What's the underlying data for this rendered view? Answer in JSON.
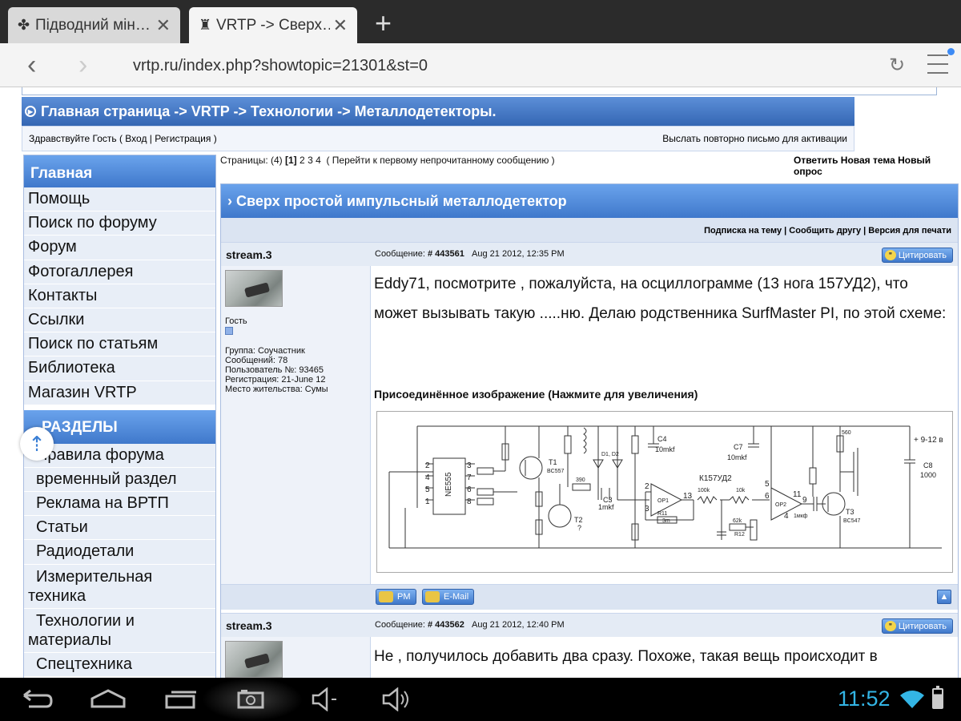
{
  "browser": {
    "tabs": [
      {
        "favicon": "✤",
        "title": "Підводний мін…",
        "active": false
      },
      {
        "favicon": "♜",
        "title": "VRTP -> Сверх…",
        "active": true
      }
    ],
    "new_tab": "+",
    "url": "vrtp.ru/index.php?showtopic=21301&st=0"
  },
  "site": {
    "breadcrumb": "Главная страница -> VRTP -> Технологии -> Металлодетекторы.",
    "welcome": "Здравствуйте Гость ( Вход | Регистрация )",
    "resend": "Выслать повторно письмо для активации"
  },
  "sidebar": {
    "main_title": "Главная",
    "main_items": [
      "Помощь",
      "Поиск по форуму",
      "Форум",
      "Фотогаллерея",
      "Контакты",
      "Ссылки",
      "Поиск по статьям",
      "Библиотека",
      "Магазин VRTP"
    ],
    "sections_title": "РАЗДЕЛЫ",
    "section_items": [
      "Правила форума",
      "временный раздел",
      "Реклама на ВРТП",
      "Статьи",
      "Радиодетали",
      "Измерительная техника",
      "Технологии и материалы",
      "Спецтехника"
    ]
  },
  "topic": {
    "pages_prefix": "Страницы: (4)",
    "current_page": "[1]",
    "other_pages": [
      "2",
      "3",
      "4"
    ],
    "first_unread": "( Перейти к первому непрочитанному сообщению )",
    "actions": "Ответить Новая тема Новый опрос",
    "title": "Сверх простой импульсный металлодетектор",
    "tools": "Подписка на тему | Сообщить другу | Версия для печати"
  },
  "posts": [
    {
      "author": "stream.3",
      "meta_label": "Сообщение:",
      "number": "# 443561",
      "date": "Aug 21 2012, 12:35 PM",
      "quote_label": "Цитировать",
      "role": "Гость",
      "group": "Группа: Соучастник",
      "messages": "Сообщений: 78",
      "user_no": "Пользователь №: 93465",
      "registered": "Регистрация: 21-June 12",
      "location": "Место жительства: Сумы",
      "body": "Eddy71, посмотрите , пожалуйста, на осциллограмме (13 нога 157УД2), что может вызывать такую .....ню. Делаю родственника SurfMaster PI, по этой схеме:",
      "attachment_title": "Присоединённое изображение (Нажмите для увеличения)",
      "pm_label": "PM",
      "email_label": "E-Mail"
    },
    {
      "author": "stream.3",
      "meta_label": "Сообщение:",
      "number": "# 443562",
      "date": "Aug 21 2012, 12:40 PM",
      "quote_label": "Цитировать",
      "body": "Не , получилось добавить два сразу. Похоже, такая вещь происходит в"
    }
  ],
  "schematic_labels": {
    "ne555": "NE555",
    "supply": "+ 9-12 в",
    "c4": "C4",
    "c4v": "10mkf",
    "c7": "C7",
    "c7v": "10mkf",
    "c3": "C3",
    "c3v": "1mkf",
    "ic": "К157УД2",
    "c8": "C8",
    "c8v": "1000",
    "t1": "T1",
    "t1v": "BC557",
    "t2": "T2",
    "t2v": "?",
    "t3": "T3",
    "t3v": "BC547",
    "op1": "OP1",
    "op2": "OP2",
    "d": "D1, D2",
    "r11": "R11",
    "r11v": "3m",
    "r12": "R12",
    "pin13": "13",
    "pin11": "11",
    "pin9": "9",
    "pin2": "2",
    "pin3": "3",
    "pin4": "4",
    "pin5": "5",
    "pin6": "6",
    "pin7": "7",
    "pin8": "8",
    "pin1": "1",
    "r100k": "100k",
    "r10k": "10k",
    "r62k": "62k",
    "r390": "390",
    "r560": "560",
    "r1mkf": "1мкф"
  },
  "system": {
    "time": "11:52"
  }
}
